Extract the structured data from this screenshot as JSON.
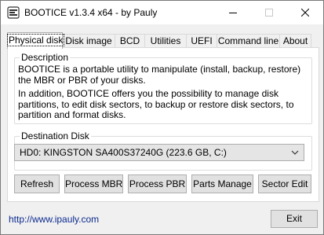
{
  "window": {
    "title": "BOOTICE v1.3.4 x64 - by Pauly"
  },
  "tabs": [
    {
      "label": "Physical disk",
      "active": true
    },
    {
      "label": "Disk image"
    },
    {
      "label": "BCD"
    },
    {
      "label": "Utilities"
    },
    {
      "label": "UEFI"
    },
    {
      "label": "Command line"
    },
    {
      "label": "About"
    }
  ],
  "description": {
    "title": "Description",
    "para1": "BOOTICE is a portable utility to manipulate (install, backup, restore) the MBR or PBR of your disks.",
    "para2": "In addition, BOOTICE offers you the possibility to manage disk partitions, to edit disk sectors, to backup or restore disk sectors, to partition and format disks."
  },
  "destination": {
    "title": "Destination Disk",
    "selected": "HD0: KINGSTON SA400S37240G (223.6 GB, C:)"
  },
  "actions": {
    "refresh": "Refresh",
    "process_mbr": "Process MBR",
    "process_pbr": "Process PBR",
    "parts_manage": "Parts Manage",
    "sector_edit": "Sector Edit"
  },
  "footer": {
    "link": "http://www.ipauly.com",
    "exit": "Exit"
  },
  "colors": {
    "link": "#0a2a8f",
    "window_bg": "#f0f0f0",
    "panel_bg": "#ffffff"
  },
  "icons": {
    "app": "app-icon",
    "minimize": "minimize-icon",
    "maximize": "maximize-icon",
    "close": "close-icon",
    "dropdown": "chevron-down-icon"
  }
}
